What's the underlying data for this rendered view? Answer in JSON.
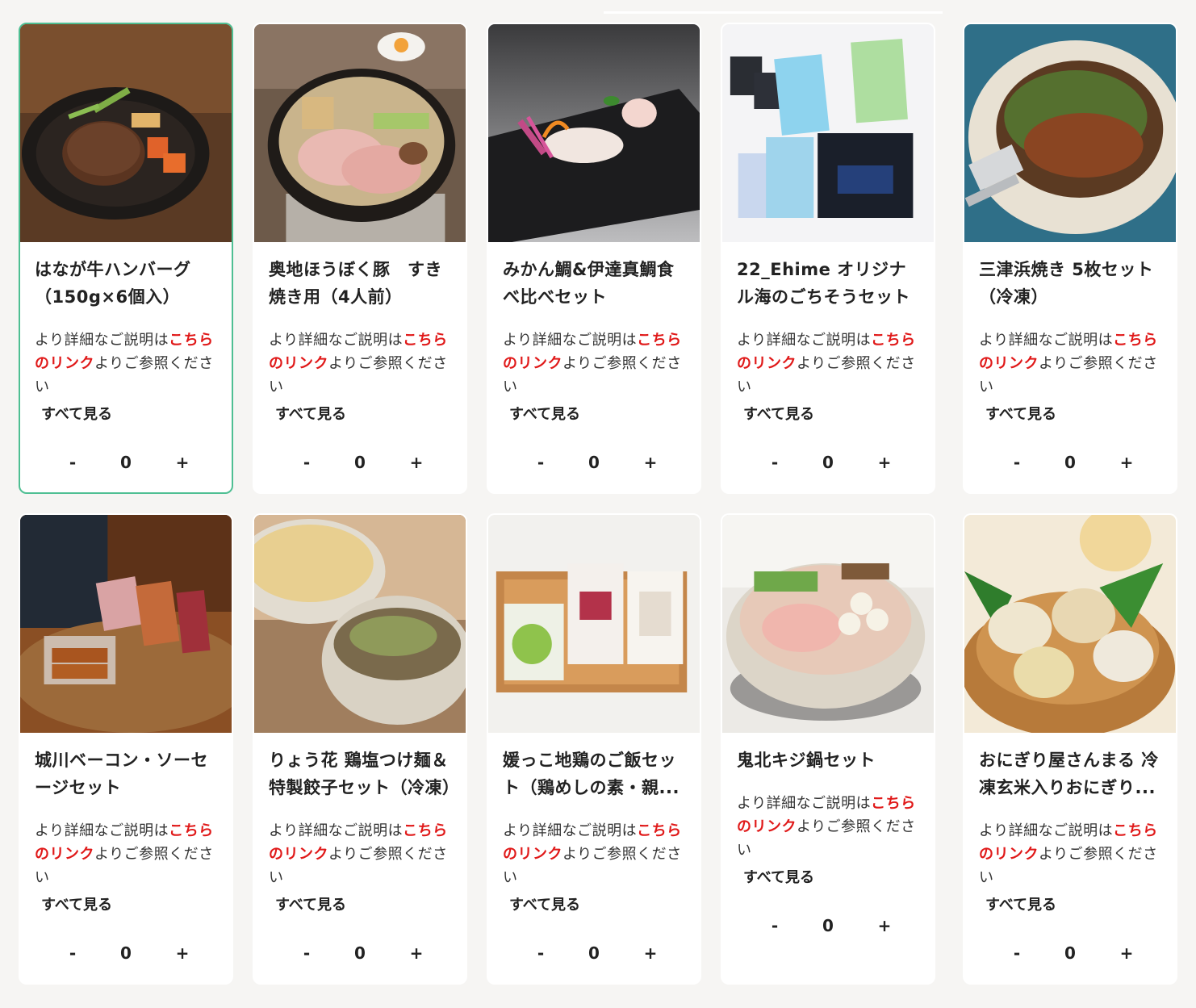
{
  "desc_prefix": "より詳細なご説明は",
  "desc_link": "こちらのリンク",
  "desc_suffix": "よりご参照ください",
  "see_all_label": "すべて見る",
  "minus_label": "-",
  "plus_label": "+",
  "colors": {
    "accent_border": "#4fbf93",
    "link_red": "#e01919",
    "background": "#f6f5f3"
  },
  "products": [
    {
      "title": "はなが牛ハンバーグ（150g×6個入）",
      "quantity": "0",
      "selected": true,
      "image": "hamburg-steak-skillet"
    },
    {
      "title": "奥地ほうぼく豚　すき焼き用（4人前）",
      "quantity": "0",
      "selected": false,
      "image": "sukiyaki-pot"
    },
    {
      "title": "みかん鯛&伊達真鯛食べ比べセット",
      "quantity": "0",
      "selected": false,
      "image": "sashimi-on-slate"
    },
    {
      "title": "22_Ehime オリジナル海のごちそうセット",
      "quantity": "0",
      "selected": false,
      "image": "seaweed-packages"
    },
    {
      "title": "三津浜焼き 5枚セット（冷凍）",
      "quantity": "0",
      "selected": false,
      "image": "okonomiyaki-plate"
    },
    {
      "title": "城川ベーコン・ソーセージセット",
      "quantity": "0",
      "selected": false,
      "image": "bacon-sausage-board"
    },
    {
      "title": "りょう花 鶏塩つけ麺＆特製餃子セット（冷凍）",
      "quantity": "0",
      "selected": false,
      "image": "tsukemen-bowls"
    },
    {
      "title": "媛っこ地鶏のご飯セット（鶏めしの素・親...",
      "quantity": "0",
      "selected": false,
      "image": "chicken-rice-packs"
    },
    {
      "title": "鬼北キジ鍋セット",
      "quantity": "0",
      "selected": false,
      "image": "pheasant-hotpot"
    },
    {
      "title": "おにぎり屋さんまる 冷凍玄米入りおにぎり...",
      "quantity": "0",
      "selected": false,
      "image": "onigiri-basket"
    }
  ]
}
